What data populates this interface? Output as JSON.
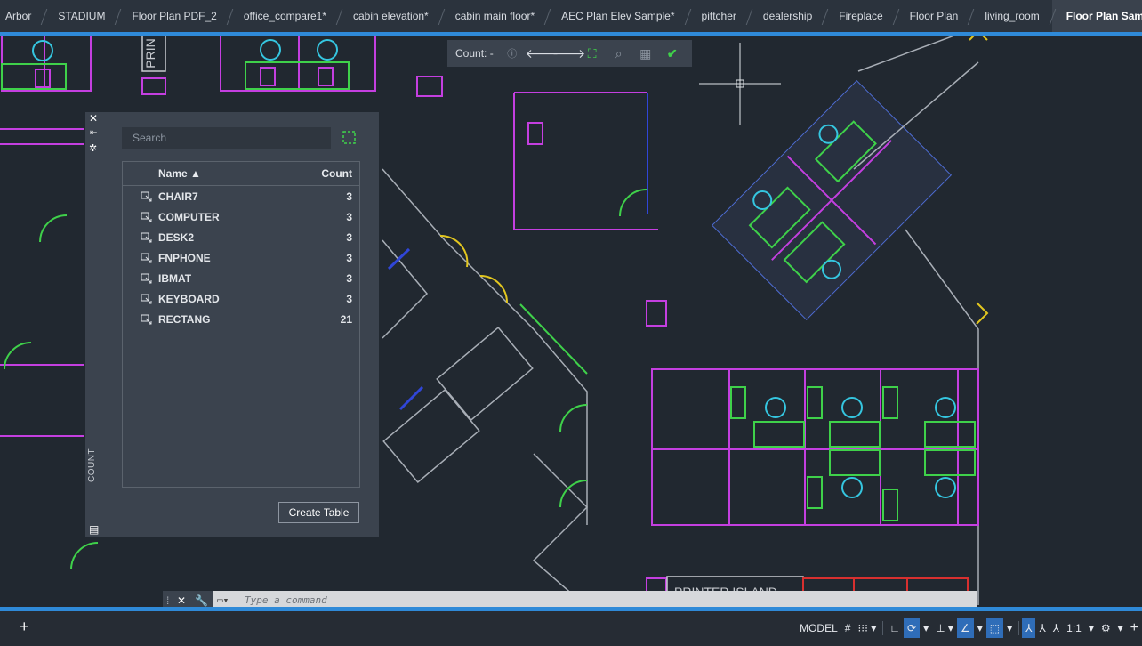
{
  "tabs": [
    {
      "label": "Arbor",
      "active": false
    },
    {
      "label": "STADIUM",
      "active": false
    },
    {
      "label": "Floor Plan PDF_2",
      "active": false
    },
    {
      "label": "office_compare1*",
      "active": false
    },
    {
      "label": "cabin elevation*",
      "active": false
    },
    {
      "label": "cabin main floor*",
      "active": false
    },
    {
      "label": "AEC Plan Elev Sample*",
      "active": false
    },
    {
      "label": "pittcher",
      "active": false
    },
    {
      "label": "dealership",
      "active": false
    },
    {
      "label": "Fireplace",
      "active": false
    },
    {
      "label": "Floor Plan",
      "active": false
    },
    {
      "label": "living_room",
      "active": false
    },
    {
      "label": "Floor Plan Samp",
      "active": true
    }
  ],
  "count_toolbar": {
    "label": "Count: -",
    "icons": [
      "info-icon",
      "prev-arrow-icon",
      "next-arrow-icon",
      "zoom-extents-icon",
      "find-icon",
      "insert-table-icon",
      "check-icon"
    ]
  },
  "palette": {
    "title": "COUNT",
    "search_placeholder": "Search",
    "col_name": "Name ▲",
    "col_count": "Count",
    "rows": [
      {
        "name": "CHAIR7",
        "count": "3"
      },
      {
        "name": "COMPUTER",
        "count": "3"
      },
      {
        "name": "DESK2",
        "count": "3"
      },
      {
        "name": "FNPHONE",
        "count": "3"
      },
      {
        "name": "IBMAT",
        "count": "3"
      },
      {
        "name": "KEYBOARD",
        "count": "3"
      },
      {
        "name": "RECTANG",
        "count": "21"
      }
    ],
    "create_table": "Create Table"
  },
  "drawing": {
    "label_printer_island": "PRINTER ISLAND",
    "label_prin": "PRIN"
  },
  "command": {
    "placeholder": "Type a command"
  },
  "status": {
    "model": "MODEL",
    "scale": "1:1"
  },
  "colors": {
    "accent": "#2f8ad8",
    "magenta": "#c43fe0",
    "green": "#3fd14a",
    "cyan": "#35c6e0",
    "yellow": "#e3c71f",
    "blue": "#3046d8"
  }
}
